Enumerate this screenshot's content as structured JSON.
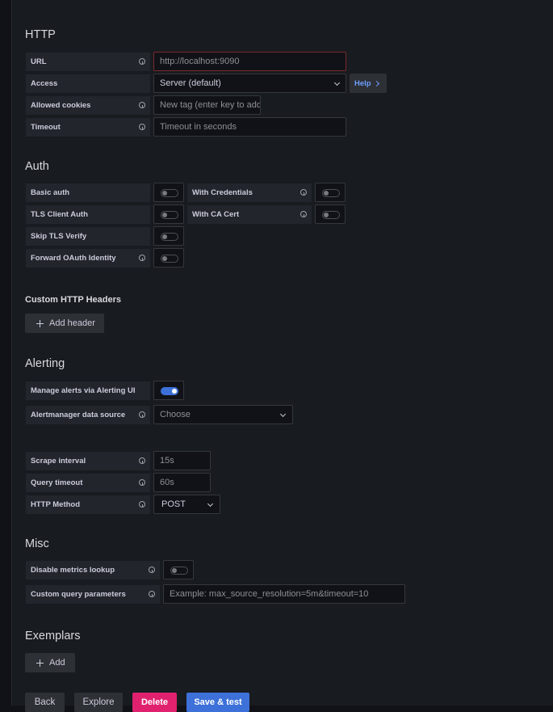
{
  "http": {
    "title": "HTTP",
    "url_label": "URL",
    "url_value": "http://localhost:9090",
    "access_label": "Access",
    "access_value": "Server (default)",
    "help_label": "Help",
    "cookies_label": "Allowed cookies",
    "cookies_placeholder": "New tag (enter key to add",
    "timeout_label": "Timeout",
    "timeout_placeholder": "Timeout in seconds"
  },
  "auth": {
    "title": "Auth",
    "basic_auth": "Basic auth",
    "with_credentials": "With Credentials",
    "tls_client_auth": "TLS Client Auth",
    "with_ca_cert": "With CA Cert",
    "skip_tls": "Skip TLS Verify",
    "forward_oauth": "Forward OAuth Identity"
  },
  "headers": {
    "title": "Custom HTTP Headers",
    "add_header": "Add header"
  },
  "alerting": {
    "title": "Alerting",
    "manage_alerts": "Manage alerts via Alerting UI",
    "manage_alerts_on": true,
    "am_source_label": "Alertmanager data source",
    "am_source_placeholder": "Choose"
  },
  "prom": {
    "scrape_label": "Scrape interval",
    "scrape_value": "15s",
    "query_timeout_label": "Query timeout",
    "query_timeout_value": "60s",
    "method_label": "HTTP Method",
    "method_value": "POST"
  },
  "misc": {
    "title": "Misc",
    "disable_metrics": "Disable metrics lookup",
    "custom_params_label": "Custom query parameters",
    "custom_params_placeholder": "Example: max_source_resolution=5m&timeout=10"
  },
  "exemplars": {
    "title": "Exemplars",
    "add": "Add"
  },
  "footer": {
    "back": "Back",
    "explore": "Explore",
    "delete": "Delete",
    "save": "Save & test"
  },
  "colors": {
    "accent": "#3d71d9",
    "danger": "#e0226e",
    "url_border": "#7a2a2a"
  },
  "icons": [
    "info-icon",
    "chevron-down-icon",
    "chevron-right-icon",
    "plus-icon"
  ]
}
